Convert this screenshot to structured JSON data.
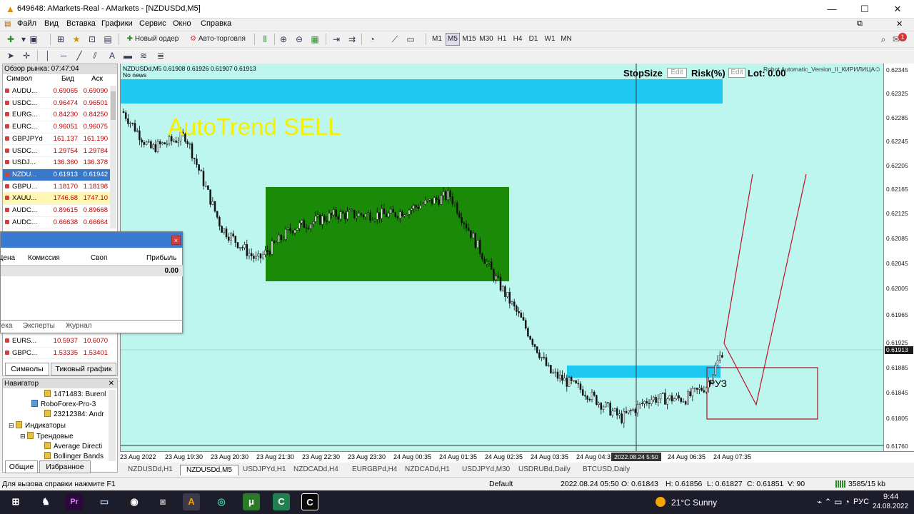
{
  "window": {
    "title": "649648: AMarkets-Real - AMarkets - [NZDUSDd,M5]",
    "minimize": "—",
    "maximize": "☐",
    "close": "✕",
    "restore_mdi": "⧉",
    "close_mdi": "✕"
  },
  "menu": [
    "Файл",
    "Вид",
    "Вставка",
    "Графики",
    "Сервис",
    "Окно",
    "Справка"
  ],
  "toolbar": {
    "new_order": "Новый ордер",
    "autotrading": "Авто-торговля",
    "timeframes": [
      "M1",
      "M5",
      "M15",
      "M30",
      "H1",
      "H4",
      "D1",
      "W1",
      "MN"
    ],
    "notifications_count": "1"
  },
  "market_watch": {
    "header": "Обзор рынка: 07:47:04",
    "columns": [
      "Символ",
      "Бид",
      "Аск"
    ],
    "rows": [
      {
        "symbol": "AUDU...",
        "bid": "0.69065",
        "ask": "0.69090"
      },
      {
        "symbol": "USDC...",
        "bid": "0.96474",
        "ask": "0.96501"
      },
      {
        "symbol": "EURG...",
        "bid": "0.84230",
        "ask": "0.84250"
      },
      {
        "symbol": "EURC...",
        "bid": "0.96051",
        "ask": "0.96075"
      },
      {
        "symbol": "GBPJPYd",
        "bid": "161.137",
        "ask": "161.190"
      },
      {
        "symbol": "USDC...",
        "bid": "1.29754",
        "ask": "1.29784"
      },
      {
        "symbol": "USDJ...",
        "bid": "136.360",
        "ask": "136.378"
      },
      {
        "symbol": "NZDU...",
        "bid": "0.61913",
        "ask": "0.61942"
      },
      {
        "symbol": "GBPU...",
        "bid": "1.18170",
        "ask": "1.18198"
      },
      {
        "symbol": "XAUU...",
        "bid": "1746.68",
        "ask": "1747.10"
      },
      {
        "symbol": "AUDC...",
        "bid": "0.89615",
        "ask": "0.89668"
      },
      {
        "symbol": "AUDC...",
        "bid": "0.66638",
        "ask": "0.66664"
      }
    ],
    "bottom_rows": [
      {
        "symbol": "EURS...",
        "bid": "10.5937",
        "ask": "10.6070"
      },
      {
        "symbol": "GBPC...",
        "bid": "1.53335",
        "ask": "1.53401"
      }
    ],
    "tabs": [
      "Символы",
      "Тиковый график"
    ]
  },
  "navigator": {
    "header": "Навигатор",
    "items": [
      "1471483: Burenl",
      "RoboForex-Pro-3",
      "23212384: Andr",
      "Индикаторы",
      "Трендовые",
      "Average Directi",
      "Bollinger Bands"
    ],
    "tabs": [
      "Общие",
      "Избранное"
    ]
  },
  "terminal": {
    "columns": [
      "Цена",
      "Комиссия",
      "Своп",
      "Прибыль"
    ],
    "profit": "0.00",
    "tabs": [
      "Библиотека",
      "Эксперты",
      "Журнал"
    ],
    "close": "×"
  },
  "chart": {
    "info": "NZDUSDd,M5  0.61908 0.61926 0.61907 0.61913",
    "news": "No news",
    "panel": {
      "stopsize": "StopSize",
      "edit1": "Edit",
      "risk": "Risk(%)",
      "edit2": "Edit",
      "lot": "Lot: 0.00"
    },
    "ea_name": "Robot Automatic_Version_II_КИРИЛИЦА",
    "signal": "AutoTrend SELL",
    "zone_label": "РУЗ",
    "cursor_time": "2022.08.24 5:50",
    "current_price": "0.61913"
  },
  "chart_data": {
    "type": "candlestick",
    "symbol": "NZDUSDd",
    "timeframe": "M5",
    "y_ticks": [
      "0.62345",
      "0.62325",
      "0.62285",
      "0.62245",
      "0.62205",
      "0.62165",
      "0.62125",
      "0.62085",
      "0.62045",
      "0.62005",
      "0.61965",
      "0.61925",
      "0.61885",
      "0.61845",
      "0.61805",
      "0.61760"
    ],
    "x_ticks": [
      "23 Aug 2022",
      "23 Aug 19:30",
      "23 Aug 20:30",
      "23 Aug 21:30",
      "23 Aug 22:30",
      "23 Aug 23:30",
      "24 Aug 00:35",
      "24 Aug 01:35",
      "24 Aug 02:35",
      "24 Aug 03:35",
      "24 Aug 04:3",
      "24 Aug 06:35",
      "24 Aug 07:35"
    ],
    "ylim": [
      0.6176,
      0.6235
    ],
    "last_price": 0.61913
  },
  "chart_tabs": [
    "NZDUSDd,H1",
    "NZDUSDd,M5",
    "USDJPYd,H1",
    "NZDCADd,H4",
    "EURGBPd,H4",
    "NZDCADd,H1",
    "USDJPYd,M30",
    "USDRUBd,Daily",
    "BTCUSD,Daily"
  ],
  "statusbar": {
    "help": "Для вызова справки нажмите F1",
    "profile": "Default",
    "time": "2022.08.24 05:50",
    "open": "O: 0.61843",
    "high": "H: 0.61856",
    "low": "L: 0.61827",
    "close": "C: 0.61851",
    "volume": "V: 90",
    "traffic": "3585/15 kb"
  },
  "taskbar": {
    "weather": "21°C  Sunny",
    "lang": "РУС",
    "time": "9:44",
    "date": "24.08.2022"
  }
}
